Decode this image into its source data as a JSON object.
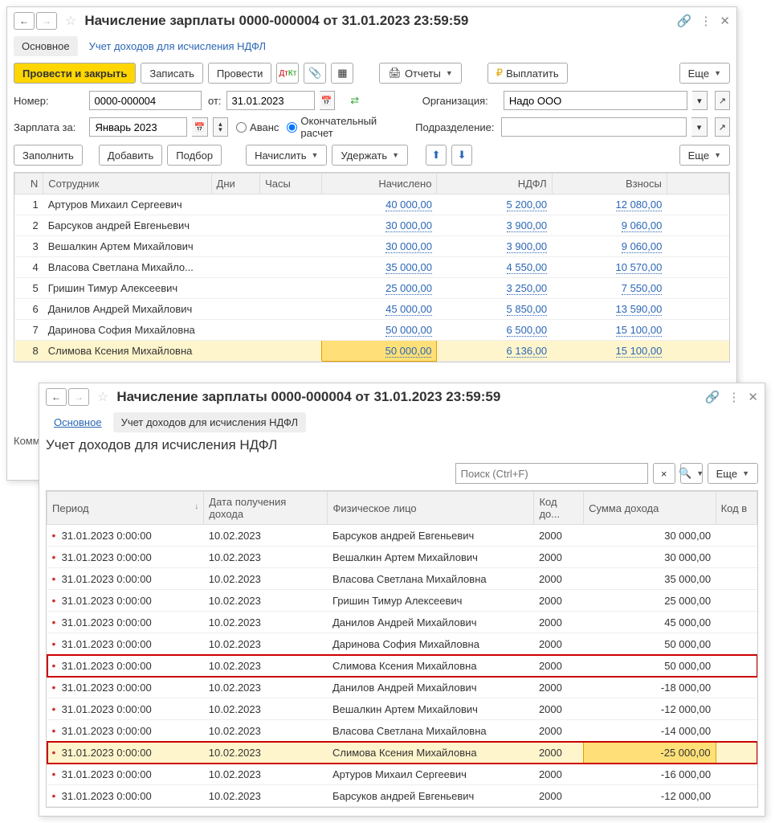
{
  "win1": {
    "title": "Начисление зарплаты 0000-000004 от 31.01.2023 23:59:59",
    "tabs": {
      "main": "Основное",
      "ndfl": "Учет доходов для исчисления НДФЛ"
    },
    "toolbar": {
      "post_close": "Провести и закрыть",
      "write": "Записать",
      "post": "Провести",
      "reports": "Отчеты",
      "pay": "Выплатить",
      "more": "Еще"
    },
    "form": {
      "number_lbl": "Номер:",
      "number_val": "0000-000004",
      "from_lbl": "от:",
      "from_val": "31.01.2023",
      "org_lbl": "Организация:",
      "org_val": "Надо ООО",
      "salary_for_lbl": "Зарплата за:",
      "salary_for_val": "Январь 2023",
      "advance_lbl": "Аванс",
      "final_lbl": "Окончательный расчет",
      "dept_lbl": "Подразделение:",
      "dept_val": ""
    },
    "toolbar2": {
      "fill": "Заполнить",
      "add": "Добавить",
      "pick": "Подбор",
      "accrue": "Начислить",
      "hold": "Удержать",
      "more": "Еще"
    },
    "grid": {
      "hdr": {
        "n": "N",
        "emp": "Сотрудник",
        "days": "Дни",
        "hours": "Часы",
        "accr": "Начислено",
        "ndfl": "НДФЛ",
        "contr": "Взносы"
      },
      "rows": [
        {
          "n": "1",
          "emp": "Артуров Михаил Сергеевич",
          "accr": "40 000,00",
          "ndfl": "5 200,00",
          "contr": "12 080,00"
        },
        {
          "n": "2",
          "emp": "Барсуков андрей Евгеньевич",
          "accr": "30 000,00",
          "ndfl": "3 900,00",
          "contr": "9 060,00"
        },
        {
          "n": "3",
          "emp": "Вешалкин Артем Михайлович",
          "accr": "30 000,00",
          "ndfl": "3 900,00",
          "contr": "9 060,00"
        },
        {
          "n": "4",
          "emp": "Власова Светлана Михайло...",
          "accr": "35 000,00",
          "ndfl": "4 550,00",
          "contr": "10 570,00"
        },
        {
          "n": "5",
          "emp": "Гришин Тимур Алексеевич",
          "accr": "25 000,00",
          "ndfl": "3 250,00",
          "contr": "7 550,00"
        },
        {
          "n": "6",
          "emp": "Данилов Андрей Михайлович",
          "accr": "45 000,00",
          "ndfl": "5 850,00",
          "contr": "13 590,00"
        },
        {
          "n": "7",
          "emp": "Даринова София Михайловна",
          "accr": "50 000,00",
          "ndfl": "6 500,00",
          "contr": "15 100,00"
        },
        {
          "n": "8",
          "emp": "Слимова Ксения Михайловна",
          "accr": "50 000,00",
          "ndfl": "6 136,00",
          "contr": "15 100,00",
          "hl": true,
          "cellhl": true
        }
      ]
    },
    "comment_lbl": "Комм"
  },
  "win2": {
    "title": "Начисление зарплаты 0000-000004 от 31.01.2023 23:59:59",
    "tabs": {
      "main": "Основное",
      "ndfl": "Учет доходов для исчисления НДФЛ"
    },
    "section": "Учет доходов для исчисления НДФЛ",
    "search_ph": "Поиск (Ctrl+F)",
    "more": "Еще",
    "grid": {
      "hdr": {
        "period": "Период",
        "date": "Дата получения дохода",
        "person": "Физическое лицо",
        "code": "Код до...",
        "sum": "Сумма дохода",
        "codex": "Код в"
      },
      "rows": [
        {
          "p": "31.01.2023 0:00:00",
          "d": "10.02.2023",
          "person": "Барсуков андрей Евгеньевич",
          "code": "2000",
          "sum": "30 000,00"
        },
        {
          "p": "31.01.2023 0:00:00",
          "d": "10.02.2023",
          "person": "Вешалкин Артем Михайлович",
          "code": "2000",
          "sum": "30 000,00"
        },
        {
          "p": "31.01.2023 0:00:00",
          "d": "10.02.2023",
          "person": "Власова Светлана Михайловна",
          "code": "2000",
          "sum": "35 000,00"
        },
        {
          "p": "31.01.2023 0:00:00",
          "d": "10.02.2023",
          "person": "Гришин Тимур Алексеевич",
          "code": "2000",
          "sum": "25 000,00"
        },
        {
          "p": "31.01.2023 0:00:00",
          "d": "10.02.2023",
          "person": "Данилов Андрей Михайлович",
          "code": "2000",
          "sum": "45 000,00"
        },
        {
          "p": "31.01.2023 0:00:00",
          "d": "10.02.2023",
          "person": "Даринова София Михайловна",
          "code": "2000",
          "sum": "50 000,00"
        },
        {
          "p": "31.01.2023 0:00:00",
          "d": "10.02.2023",
          "person": "Слимова Ксения Михайловна",
          "code": "2000",
          "sum": "50 000,00",
          "red": true
        },
        {
          "p": "31.01.2023 0:00:00",
          "d": "10.02.2023",
          "person": "Данилов Андрей Михайлович",
          "code": "2000",
          "sum": "-18 000,00"
        },
        {
          "p": "31.01.2023 0:00:00",
          "d": "10.02.2023",
          "person": "Вешалкин Артем Михайлович",
          "code": "2000",
          "sum": "-12 000,00"
        },
        {
          "p": "31.01.2023 0:00:00",
          "d": "10.02.2023",
          "person": "Власова Светлана Михайловна",
          "code": "2000",
          "sum": "-14 000,00"
        },
        {
          "p": "31.01.2023 0:00:00",
          "d": "10.02.2023",
          "person": "Слимова Ксения Михайловна",
          "code": "2000",
          "sum": "-25 000,00",
          "red": true,
          "hl": true,
          "cellhl": true
        },
        {
          "p": "31.01.2023 0:00:00",
          "d": "10.02.2023",
          "person": "Артуров Михаил Сергеевич",
          "code": "2000",
          "sum": "-16 000,00"
        },
        {
          "p": "31.01.2023 0:00:00",
          "d": "10.02.2023",
          "person": "Барсуков андрей Евгеньевич",
          "code": "2000",
          "sum": "-12 000,00"
        }
      ]
    }
  }
}
